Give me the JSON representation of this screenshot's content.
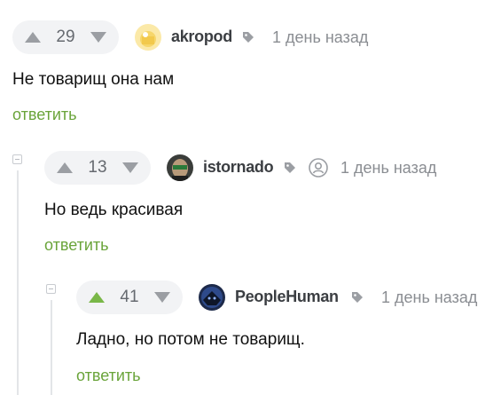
{
  "comments": [
    {
      "rating": "29",
      "username": "akropod",
      "time": "1 день назад",
      "text": "Не товарищ она нам",
      "reply_label": "ответить"
    },
    {
      "rating": "13",
      "username": "istornado",
      "time": "1 день назад",
      "text": "Но ведь красивая",
      "reply_label": "ответить"
    },
    {
      "rating": "41",
      "username": "PeopleHuman",
      "time": "1 день назад",
      "text": "Ладно, но потом не товарищ.",
      "reply_label": "ответить"
    }
  ],
  "colors": {
    "accent": "#6aa43a",
    "upvote_active": "#79b748",
    "muted": "#9b9ea3"
  },
  "icons": [
    "arrow-up-icon",
    "arrow-down-icon",
    "tag-icon",
    "anonymous-user-icon",
    "collapse-icon"
  ]
}
